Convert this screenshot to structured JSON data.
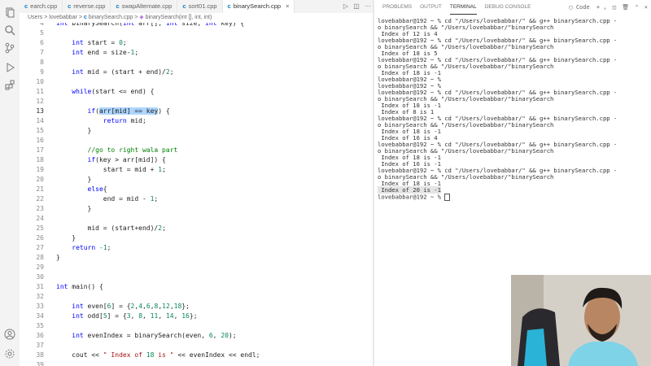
{
  "tabs": [
    {
      "label": "earch.cpp",
      "active": false
    },
    {
      "label": "reverse.cpp",
      "active": false
    },
    {
      "label": "swapAlternate.cpp",
      "active": false
    },
    {
      "label": "sort01.cpp",
      "active": false
    },
    {
      "label": "binarySearch.cpp",
      "active": true
    }
  ],
  "breadcrumb": {
    "users": "Users",
    "sep": ">",
    "user": "lovebabbar",
    "file": "binarySearch.cpp",
    "func": "binarySearch(int [], int, int)"
  },
  "code_lines": [
    {
      "n": "4",
      "t": "int binarySearch(int arr[], int size, int key) {"
    },
    {
      "n": "5",
      "t": ""
    },
    {
      "n": "6",
      "t": "    int start = 0;"
    },
    {
      "n": "7",
      "t": "    int end = size-1;"
    },
    {
      "n": "8",
      "t": ""
    },
    {
      "n": "9",
      "t": "    int mid = (start + end)/2;"
    },
    {
      "n": "10",
      "t": ""
    },
    {
      "n": "11",
      "t": "    while(start <= end) {"
    },
    {
      "n": "12",
      "t": ""
    },
    {
      "n": "13",
      "t": "        if(arr[mid] == key) {"
    },
    {
      "n": "14",
      "t": "            return mid;"
    },
    {
      "n": "15",
      "t": "        }"
    },
    {
      "n": "16",
      "t": ""
    },
    {
      "n": "17",
      "t": "        //go to right wala part"
    },
    {
      "n": "18",
      "t": "        if(key > arr[mid]) {"
    },
    {
      "n": "19",
      "t": "            start = mid + 1;"
    },
    {
      "n": "20",
      "t": "        }"
    },
    {
      "n": "21",
      "t": "        else{"
    },
    {
      "n": "22",
      "t": "            end = mid - 1;"
    },
    {
      "n": "23",
      "t": "        }"
    },
    {
      "n": "24",
      "t": ""
    },
    {
      "n": "25",
      "t": "        mid = (start+end)/2;"
    },
    {
      "n": "26",
      "t": "    }"
    },
    {
      "n": "27",
      "t": "    return -1;"
    },
    {
      "n": "28",
      "t": "}"
    },
    {
      "n": "29",
      "t": ""
    },
    {
      "n": "30",
      "t": ""
    },
    {
      "n": "31",
      "t": "int main() {"
    },
    {
      "n": "32",
      "t": ""
    },
    {
      "n": "33",
      "t": "    int even[6] = {2,4,6,8,12,18};"
    },
    {
      "n": "34",
      "t": "    int odd[5] = {3, 8, 11, 14, 16};"
    },
    {
      "n": "35",
      "t": ""
    },
    {
      "n": "36",
      "t": "    int evenIndex = binarySearch(even, 6, 20);"
    },
    {
      "n": "37",
      "t": ""
    },
    {
      "n": "38",
      "t": "    cout << \" Index of 18 is \" << evenIndex << endl;"
    },
    {
      "n": "39",
      "t": ""
    }
  ],
  "panel_tabs": [
    "PROBLEMS",
    "OUTPUT",
    "TERMINAL",
    "DEBUG CONSOLE"
  ],
  "panel_active": "TERMINAL",
  "panel_action_label": "Code",
  "terminal_lines": [
    "lovebabbar@192 ~ % cd \"/Users/lovebabbar/\" && g++ binarySearch.cpp -",
    "o binarySearch && \"/Users/lovebabbar/\"binarySearch",
    " Index of 12 is 4",
    "lovebabbar@192 ~ % cd \"/Users/lovebabbar/\" && g++ binarySearch.cpp -",
    "o binarySearch && \"/Users/lovebabbar/\"binarySearch",
    " Index of 18 is 5",
    "lovebabbar@192 ~ % cd \"/Users/lovebabbar/\" && g++ binarySearch.cpp -",
    "o binarySearch && \"/Users/lovebabbar/\"binarySearch",
    " Index of 18 is -1",
    "lovebabbar@192 ~ %",
    "lovebabbar@192 ~ %",
    "lovebabbar@192 ~ % cd \"/Users/lovebabbar/\" && g++ binarySearch.cpp -",
    "o binarySearch && \"/Users/lovebabbar/\"binarySearch",
    " Index of 18 is -1",
    " Index of 8 is 1",
    "lovebabbar@192 ~ % cd \"/Users/lovebabbar/\" && g++ binarySearch.cpp -",
    "o binarySearch && \"/Users/lovebabbar/\"binarySearch",
    " Index of 18 is -1",
    " Index of 16 is 4",
    "lovebabbar@192 ~ % cd \"/Users/lovebabbar/\" && g++ binarySearch.cpp -",
    "o binarySearch && \"/Users/lovebabbar/\"binarySearch",
    " Index of 18 is -1",
    " Index of 16 is -1",
    "lovebabbar@192 ~ % cd \"/Users/lovebabbar/\" && g++ binarySearch.cpp -",
    "o binarySearch && \"/Users/lovebabbar/\"binarySearch",
    " Index of 18 is -1",
    " Index of 20 is -1",
    "lovebabbar@192 ~ % "
  ],
  "terminal_highlight_line": 26,
  "colors": {
    "keyword": "#0000ff",
    "number": "#098658",
    "comment": "#008000",
    "string": "#a31515",
    "selection": "#add6ff",
    "accent": "#0a7fc6"
  }
}
